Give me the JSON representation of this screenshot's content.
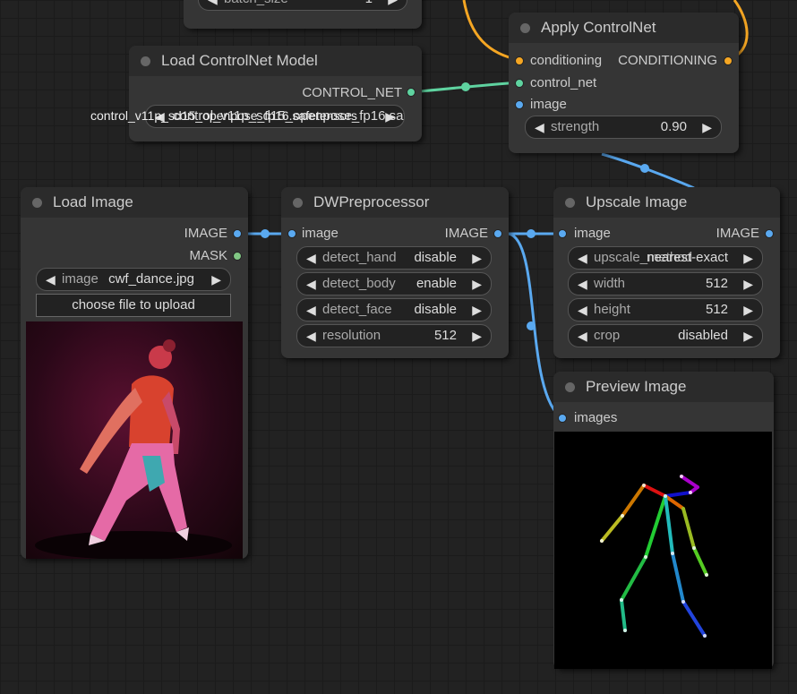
{
  "colors": {
    "image": "#5aa9f0",
    "conditioning": "#f5a623",
    "control_net": "#5fd3a0",
    "mask": "#81c784"
  },
  "partial_node": {
    "widget_label": "batch_size",
    "widget_value": "1"
  },
  "load_controlnet": {
    "title": "Load ControlNet Model",
    "output": "CONTROL_NET",
    "widget_value": "control_v11p_sd15_openpose_fp16.safetensors",
    "overlay_label": "control_v11p_sd15_openpose_fp16.safetensors"
  },
  "apply_controlnet": {
    "title": "Apply ControlNet",
    "inputs": [
      "conditioning",
      "control_net",
      "image"
    ],
    "output": "CONDITIONING",
    "strength_label": "strength",
    "strength_value": "0.90"
  },
  "load_image": {
    "title": "Load Image",
    "outputs": [
      "IMAGE",
      "MASK"
    ],
    "image_label": "image",
    "image_value": "cwf_dance.jpg",
    "upload_button": "choose file to upload"
  },
  "dwpreprocessor": {
    "title": "DWPreprocessor",
    "input": "image",
    "output": "IMAGE",
    "widgets": [
      {
        "label": "detect_hand",
        "value": "disable"
      },
      {
        "label": "detect_body",
        "value": "enable"
      },
      {
        "label": "detect_face",
        "value": "disable"
      },
      {
        "label": "resolution",
        "value": "512"
      }
    ]
  },
  "upscale_image": {
    "title": "Upscale Image",
    "input": "image",
    "output": "IMAGE",
    "widgets": [
      {
        "label": "upscale_method",
        "value": "nearest-exact"
      },
      {
        "label": "width",
        "value": "512"
      },
      {
        "label": "height",
        "value": "512"
      },
      {
        "label": "crop",
        "value": "disabled"
      }
    ]
  },
  "preview_image": {
    "title": "Preview Image",
    "input": "images"
  }
}
